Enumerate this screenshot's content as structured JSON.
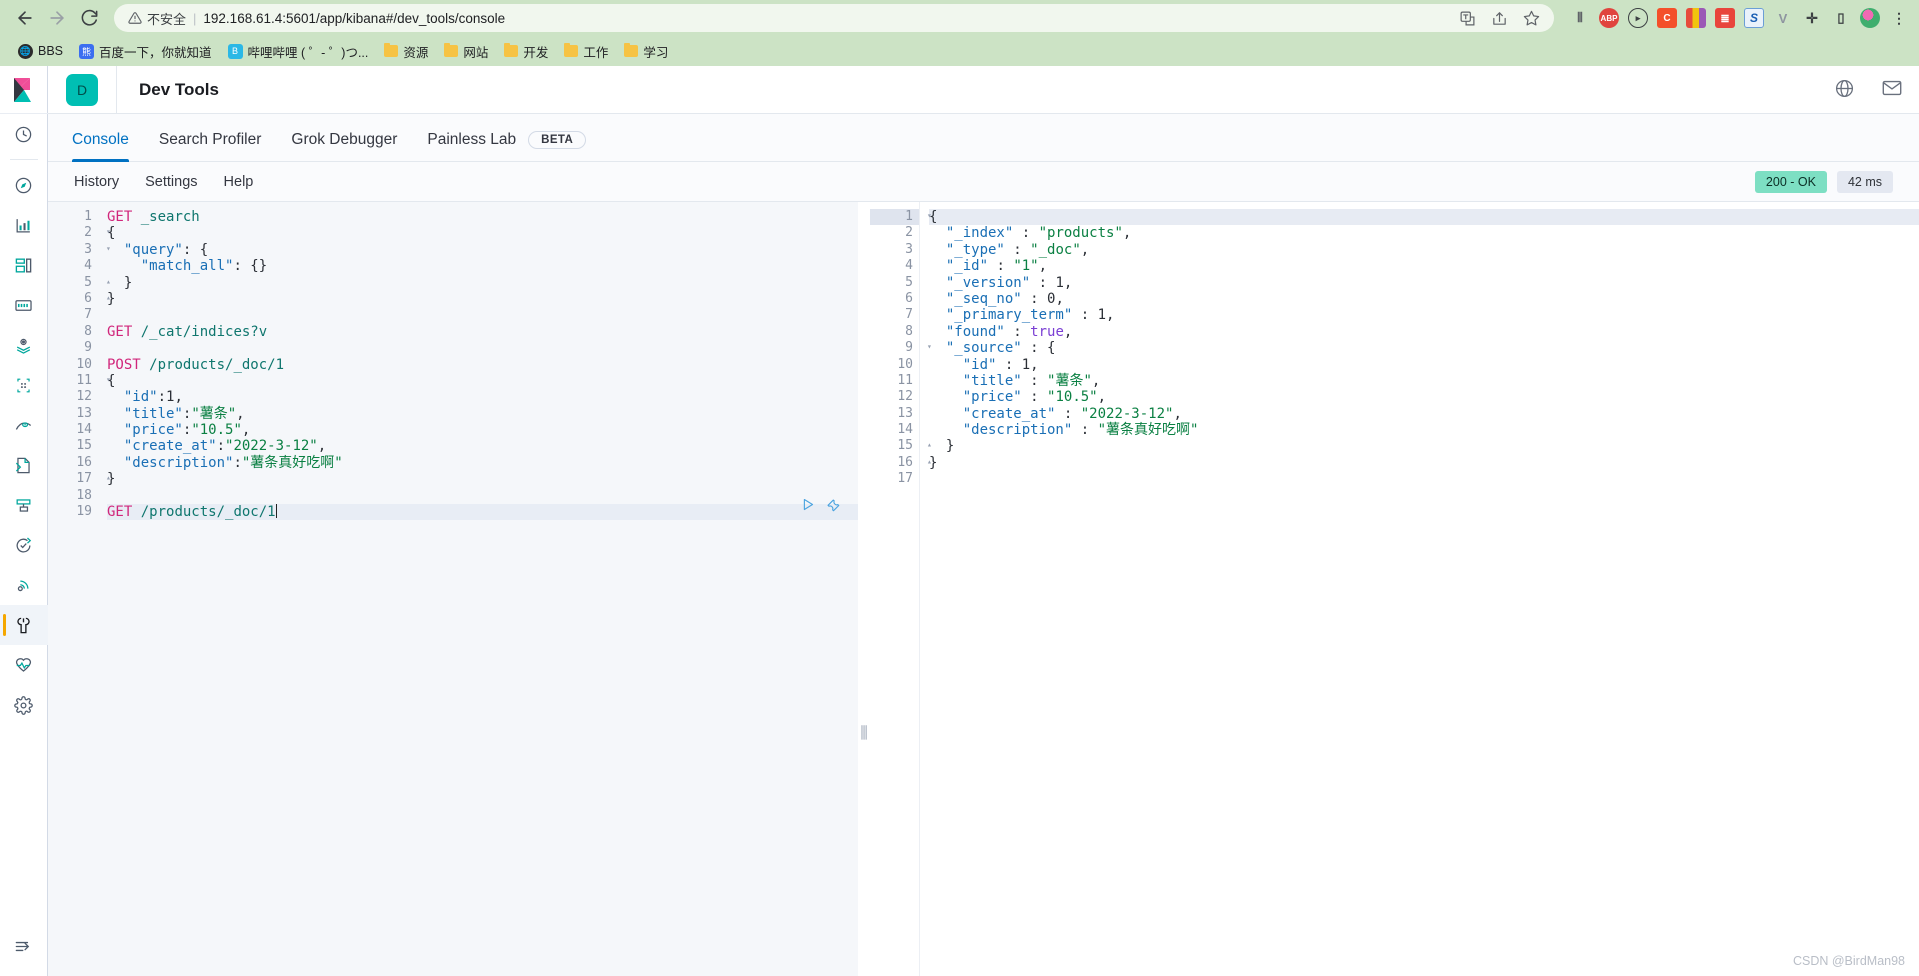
{
  "browser": {
    "back_icon": "arrow-left-icon",
    "forward_icon": "arrow-right-icon",
    "reload_icon": "reload-icon",
    "security_warning": "不安全",
    "url": "192.168.61.4:5601/app/kibana#/dev_tools/console",
    "omnibox_icons": [
      "translate-icon",
      "share-icon",
      "bookmark-star-icon"
    ],
    "extensions": [
      {
        "name": "reader-mode-icon",
        "label": "≡"
      },
      {
        "name": "adblock-plus-icon",
        "label": "ABP"
      },
      {
        "name": "media-play-icon",
        "label": "▸"
      },
      {
        "name": "c-extension-icon",
        "label": "C"
      },
      {
        "name": "colorpicker-icon",
        "label": ""
      },
      {
        "name": "notes-icon",
        "label": "≣"
      },
      {
        "name": "s-extension-icon",
        "label": "S"
      },
      {
        "name": "v-extension-icon",
        "label": "V"
      },
      {
        "name": "puzzle-extensions-icon",
        "label": "✛"
      },
      {
        "name": "sidepanel-icon",
        "label": "▯"
      },
      {
        "name": "profile-avatar-icon",
        "label": ""
      },
      {
        "name": "chrome-menu-icon",
        "label": "⋮"
      }
    ],
    "bookmarks": [
      {
        "label": "BBS",
        "icon": "globe-icon",
        "type": "site"
      },
      {
        "label": "百度一下，你就知道",
        "icon": "baidu-icon",
        "type": "site"
      },
      {
        "label": "哔哩哔哩 ( ゜- ゜)つ...",
        "icon": "bilibili-icon",
        "type": "site"
      },
      {
        "label": "资源",
        "icon": "folder-icon",
        "type": "folder"
      },
      {
        "label": "网站",
        "icon": "folder-icon",
        "type": "folder"
      },
      {
        "label": "开发",
        "icon": "folder-icon",
        "type": "folder"
      },
      {
        "label": "工作",
        "icon": "folder-icon",
        "type": "folder"
      },
      {
        "label": "学习",
        "icon": "folder-icon",
        "type": "folder"
      }
    ]
  },
  "sidebar": {
    "logo": "kibana-logo-icon",
    "items": [
      {
        "name": "recently-viewed-icon"
      },
      {
        "name": "discover-icon"
      },
      {
        "name": "visualize-icon"
      },
      {
        "name": "dashboard-icon"
      },
      {
        "name": "canvas-icon"
      },
      {
        "name": "maps-icon"
      },
      {
        "name": "machine-learning-icon"
      },
      {
        "name": "infrastructure-icon"
      },
      {
        "name": "logs-icon"
      },
      {
        "name": "apm-icon"
      },
      {
        "name": "uptime-icon"
      },
      {
        "name": "siem-icon"
      },
      {
        "name": "dev-tools-icon"
      },
      {
        "name": "monitoring-icon"
      },
      {
        "name": "management-icon"
      }
    ],
    "collapse_icon": "collapse-arrow-icon",
    "selected_index": 12,
    "accent_color": "#f5a700"
  },
  "header": {
    "avatar_letter": "D",
    "title": "Dev Tools",
    "avatar_color": "#00bfb3",
    "right_icons": [
      "help-globe-icon",
      "mail-icon"
    ]
  },
  "tabs": [
    {
      "label": "Console",
      "active": true
    },
    {
      "label": "Search Profiler",
      "active": false
    },
    {
      "label": "Grok Debugger",
      "active": false
    },
    {
      "label": "Painless Lab",
      "active": false,
      "badge": "BETA"
    }
  ],
  "console_toolbar": {
    "history": "History",
    "settings": "Settings",
    "help": "Help",
    "status_code": "200 - OK",
    "status_color": "#7ddfc3",
    "duration": "42 ms"
  },
  "request_editor": {
    "line_actions": [
      "play-triangle-icon",
      "wrench-icon"
    ],
    "active_line": 19,
    "lines": [
      {
        "n": 1,
        "fold": "",
        "tokens": [
          {
            "t": "GET",
            "c": "k-method"
          },
          {
            "t": " ",
            "c": "k-punc"
          },
          {
            "t": "_search",
            "c": "k-url"
          }
        ]
      },
      {
        "n": 2,
        "fold": "▾",
        "tokens": [
          {
            "t": "{",
            "c": "k-punc"
          }
        ]
      },
      {
        "n": 3,
        "fold": "▾",
        "tokens": [
          {
            "t": "  ",
            "c": "k-punc"
          },
          {
            "t": "\"query\"",
            "c": "k-key"
          },
          {
            "t": ": {",
            "c": "k-punc"
          }
        ]
      },
      {
        "n": 4,
        "fold": "",
        "tokens": [
          {
            "t": "    ",
            "c": "k-punc"
          },
          {
            "t": "\"match_all\"",
            "c": "k-key"
          },
          {
            "t": ": {}",
            "c": "k-punc"
          }
        ]
      },
      {
        "n": 5,
        "fold": "▴",
        "tokens": [
          {
            "t": "  }",
            "c": "k-punc"
          }
        ]
      },
      {
        "n": 6,
        "fold": "▴",
        "tokens": [
          {
            "t": "}",
            "c": "k-punc"
          }
        ]
      },
      {
        "n": 7,
        "fold": "",
        "tokens": []
      },
      {
        "n": 8,
        "fold": "",
        "tokens": [
          {
            "t": "GET",
            "c": "k-method"
          },
          {
            "t": " ",
            "c": "k-punc"
          },
          {
            "t": "/_cat/indices?v",
            "c": "k-url"
          }
        ]
      },
      {
        "n": 9,
        "fold": "",
        "tokens": []
      },
      {
        "n": 10,
        "fold": "",
        "tokens": [
          {
            "t": "POST",
            "c": "k-method"
          },
          {
            "t": " ",
            "c": "k-punc"
          },
          {
            "t": "/products/_doc/1",
            "c": "k-url"
          }
        ]
      },
      {
        "n": 11,
        "fold": "▾",
        "tokens": [
          {
            "t": "{",
            "c": "k-punc"
          }
        ]
      },
      {
        "n": 12,
        "fold": "",
        "tokens": [
          {
            "t": "  ",
            "c": "k-punc"
          },
          {
            "t": "\"id\"",
            "c": "k-key"
          },
          {
            "t": ":",
            "c": "k-punc"
          },
          {
            "t": "1",
            "c": "k-num"
          },
          {
            "t": ",",
            "c": "k-punc"
          }
        ]
      },
      {
        "n": 13,
        "fold": "",
        "tokens": [
          {
            "t": "  ",
            "c": "k-punc"
          },
          {
            "t": "\"title\"",
            "c": "k-key"
          },
          {
            "t": ":",
            "c": "k-punc"
          },
          {
            "t": "\"薯条\"",
            "c": "k-str"
          },
          {
            "t": ",",
            "c": "k-punc"
          }
        ]
      },
      {
        "n": 14,
        "fold": "",
        "tokens": [
          {
            "t": "  ",
            "c": "k-punc"
          },
          {
            "t": "\"price\"",
            "c": "k-key"
          },
          {
            "t": ":",
            "c": "k-punc"
          },
          {
            "t": "\"10.5\"",
            "c": "k-str"
          },
          {
            "t": ",",
            "c": "k-punc"
          }
        ]
      },
      {
        "n": 15,
        "fold": "",
        "tokens": [
          {
            "t": "  ",
            "c": "k-punc"
          },
          {
            "t": "\"create_at\"",
            "c": "k-key"
          },
          {
            "t": ":",
            "c": "k-punc"
          },
          {
            "t": "\"2022-3-12\"",
            "c": "k-str"
          },
          {
            "t": ",",
            "c": "k-punc"
          }
        ]
      },
      {
        "n": 16,
        "fold": "",
        "tokens": [
          {
            "t": "  ",
            "c": "k-punc"
          },
          {
            "t": "\"description\"",
            "c": "k-key"
          },
          {
            "t": ":",
            "c": "k-punc"
          },
          {
            "t": "\"薯条真好吃啊\"",
            "c": "k-str"
          }
        ]
      },
      {
        "n": 17,
        "fold": "▴",
        "tokens": [
          {
            "t": "}",
            "c": "k-punc"
          }
        ]
      },
      {
        "n": 18,
        "fold": "",
        "tokens": []
      },
      {
        "n": 19,
        "fold": "",
        "tokens": [
          {
            "t": "GET",
            "c": "k-method"
          },
          {
            "t": " ",
            "c": "k-punc"
          },
          {
            "t": "/products/_doc/1",
            "c": "k-url"
          }
        ]
      }
    ]
  },
  "response_editor": {
    "lines": [
      {
        "n": 1,
        "fold": "▾",
        "hl": true,
        "tokens": [
          {
            "t": "{",
            "c": "k-punc"
          }
        ]
      },
      {
        "n": 2,
        "fold": "",
        "hl": false,
        "tokens": [
          {
            "t": "  ",
            "c": "k-punc"
          },
          {
            "t": "\"_index\"",
            "c": "k-key"
          },
          {
            "t": " : ",
            "c": "k-punc"
          },
          {
            "t": "\"products\"",
            "c": "k-str"
          },
          {
            "t": ",",
            "c": "k-punc"
          }
        ]
      },
      {
        "n": 3,
        "fold": "",
        "hl": false,
        "tokens": [
          {
            "t": "  ",
            "c": "k-punc"
          },
          {
            "t": "\"_type\"",
            "c": "k-key"
          },
          {
            "t": " : ",
            "c": "k-punc"
          },
          {
            "t": "\"_doc\"",
            "c": "k-str"
          },
          {
            "t": ",",
            "c": "k-punc"
          }
        ]
      },
      {
        "n": 4,
        "fold": "",
        "hl": false,
        "tokens": [
          {
            "t": "  ",
            "c": "k-punc"
          },
          {
            "t": "\"_id\"",
            "c": "k-key"
          },
          {
            "t": " : ",
            "c": "k-punc"
          },
          {
            "t": "\"1\"",
            "c": "k-str"
          },
          {
            "t": ",",
            "c": "k-punc"
          }
        ]
      },
      {
        "n": 5,
        "fold": "",
        "hl": false,
        "tokens": [
          {
            "t": "  ",
            "c": "k-punc"
          },
          {
            "t": "\"_version\"",
            "c": "k-key"
          },
          {
            "t": " : ",
            "c": "k-punc"
          },
          {
            "t": "1",
            "c": "k-num"
          },
          {
            "t": ",",
            "c": "k-punc"
          }
        ]
      },
      {
        "n": 6,
        "fold": "",
        "hl": false,
        "tokens": [
          {
            "t": "  ",
            "c": "k-punc"
          },
          {
            "t": "\"_seq_no\"",
            "c": "k-key"
          },
          {
            "t": " : ",
            "c": "k-punc"
          },
          {
            "t": "0",
            "c": "k-num"
          },
          {
            "t": ",",
            "c": "k-punc"
          }
        ]
      },
      {
        "n": 7,
        "fold": "",
        "hl": false,
        "tokens": [
          {
            "t": "  ",
            "c": "k-punc"
          },
          {
            "t": "\"_primary_term\"",
            "c": "k-key"
          },
          {
            "t": " : ",
            "c": "k-punc"
          },
          {
            "t": "1",
            "c": "k-num"
          },
          {
            "t": ",",
            "c": "k-punc"
          }
        ]
      },
      {
        "n": 8,
        "fold": "",
        "hl": false,
        "tokens": [
          {
            "t": "  ",
            "c": "k-punc"
          },
          {
            "t": "\"found\"",
            "c": "k-key"
          },
          {
            "t": " : ",
            "c": "k-punc"
          },
          {
            "t": "true",
            "c": "k-bool"
          },
          {
            "t": ",",
            "c": "k-punc"
          }
        ]
      },
      {
        "n": 9,
        "fold": "▾",
        "hl": false,
        "tokens": [
          {
            "t": "  ",
            "c": "k-punc"
          },
          {
            "t": "\"_source\"",
            "c": "k-key"
          },
          {
            "t": " : {",
            "c": "k-punc"
          }
        ]
      },
      {
        "n": 10,
        "fold": "",
        "hl": false,
        "tokens": [
          {
            "t": "    ",
            "c": "k-punc"
          },
          {
            "t": "\"id\"",
            "c": "k-key"
          },
          {
            "t": " : ",
            "c": "k-punc"
          },
          {
            "t": "1",
            "c": "k-num"
          },
          {
            "t": ",",
            "c": "k-punc"
          }
        ]
      },
      {
        "n": 11,
        "fold": "",
        "hl": false,
        "tokens": [
          {
            "t": "    ",
            "c": "k-punc"
          },
          {
            "t": "\"title\"",
            "c": "k-key"
          },
          {
            "t": " : ",
            "c": "k-punc"
          },
          {
            "t": "\"薯条\"",
            "c": "k-str"
          },
          {
            "t": ",",
            "c": "k-punc"
          }
        ]
      },
      {
        "n": 12,
        "fold": "",
        "hl": false,
        "tokens": [
          {
            "t": "    ",
            "c": "k-punc"
          },
          {
            "t": "\"price\"",
            "c": "k-key"
          },
          {
            "t": " : ",
            "c": "k-punc"
          },
          {
            "t": "\"10.5\"",
            "c": "k-str"
          },
          {
            "t": ",",
            "c": "k-punc"
          }
        ]
      },
      {
        "n": 13,
        "fold": "",
        "hl": false,
        "tokens": [
          {
            "t": "    ",
            "c": "k-punc"
          },
          {
            "t": "\"create_at\"",
            "c": "k-key"
          },
          {
            "t": " : ",
            "c": "k-punc"
          },
          {
            "t": "\"2022-3-12\"",
            "c": "k-str"
          },
          {
            "t": ",",
            "c": "k-punc"
          }
        ]
      },
      {
        "n": 14,
        "fold": "",
        "hl": false,
        "tokens": [
          {
            "t": "    ",
            "c": "k-punc"
          },
          {
            "t": "\"description\"",
            "c": "k-key"
          },
          {
            "t": " : ",
            "c": "k-punc"
          },
          {
            "t": "\"薯条真好吃啊\"",
            "c": "k-str"
          }
        ]
      },
      {
        "n": 15,
        "fold": "▴",
        "hl": false,
        "tokens": [
          {
            "t": "  }",
            "c": "k-punc"
          }
        ]
      },
      {
        "n": 16,
        "fold": "▴",
        "hl": false,
        "tokens": [
          {
            "t": "}",
            "c": "k-punc"
          }
        ]
      },
      {
        "n": 17,
        "fold": "",
        "hl": false,
        "tokens": []
      }
    ]
  },
  "watermark": "CSDN @BirdMan98"
}
